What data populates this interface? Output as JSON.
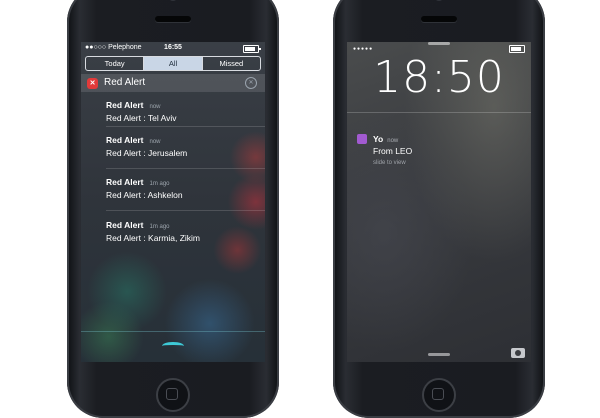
{
  "left_phone": {
    "status": {
      "carrier": "●●○○○ Pelephone",
      "time": "16:55"
    },
    "tabs": [
      {
        "label": "Today"
      },
      {
        "label": "All"
      },
      {
        "label": "Missed"
      }
    ],
    "app": {
      "name": "Red Alert",
      "close": "✕"
    },
    "notifications": [
      {
        "title": "Red Alert",
        "time": "now",
        "body": "Red Alert : Tel Aviv"
      },
      {
        "title": "Red Alert",
        "time": "now",
        "body": "Red Alert : Jerusalem"
      },
      {
        "title": "Red Alert",
        "time": "1m ago",
        "body": "Red Alert : Ashkelon"
      },
      {
        "title": "Red Alert",
        "time": "1m ago",
        "body": "Red Alert : Karmia, Zikim"
      }
    ]
  },
  "right_phone": {
    "status": {
      "signal": "●●●●●"
    },
    "clock": "18:50",
    "notification": {
      "app": "Yo",
      "time": "now",
      "body": "From LEO",
      "hint": "slide to view"
    }
  },
  "colors": {
    "accent": "#3ec9d6",
    "alert_red": "#e23a3a",
    "yo_purple": "#a25ad1"
  }
}
